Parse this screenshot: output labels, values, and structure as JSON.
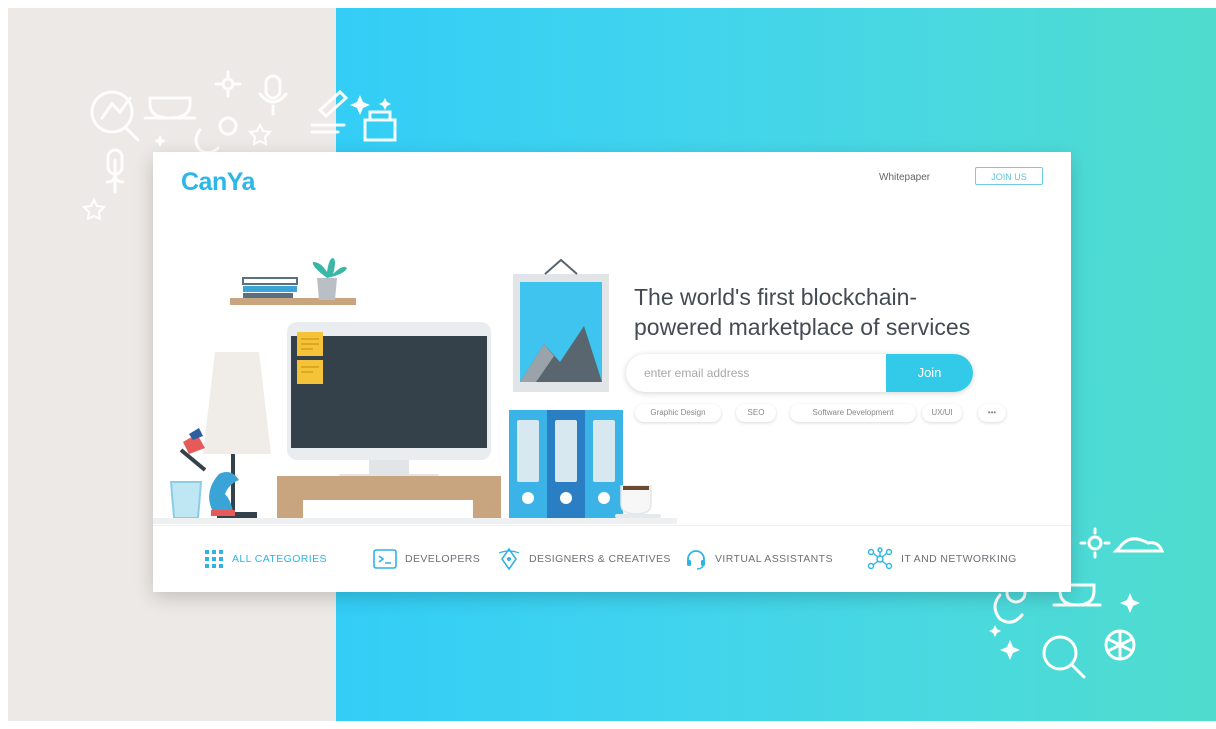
{
  "brand": {
    "logo_text": "CanYa"
  },
  "header": {
    "whitepaper_label": "Whitepaper",
    "join_us_label": "JOIN US"
  },
  "hero": {
    "headline_line1": "The world's first blockchain-",
    "headline_line2": "powered marketplace of services",
    "email_placeholder": "enter email address",
    "join_label": "Join",
    "tags": [
      "Graphic Design",
      "SEO",
      "Software Development",
      "UX/UI",
      "•••"
    ]
  },
  "categories": {
    "all": "ALL CATEGORIES",
    "developers": "DEVELOPERS",
    "designers": "DESIGNERS & CREATIVES",
    "assistants": "VIRTUAL ASSISTANTS",
    "networking": "IT AND NETWORKING"
  },
  "colors": {
    "accent": "#33c9e8",
    "brand": "#2bb7e8",
    "gradient_start": "#33cdf6",
    "gradient_end": "#4fdccd",
    "left_panel": "#ece9e6"
  }
}
